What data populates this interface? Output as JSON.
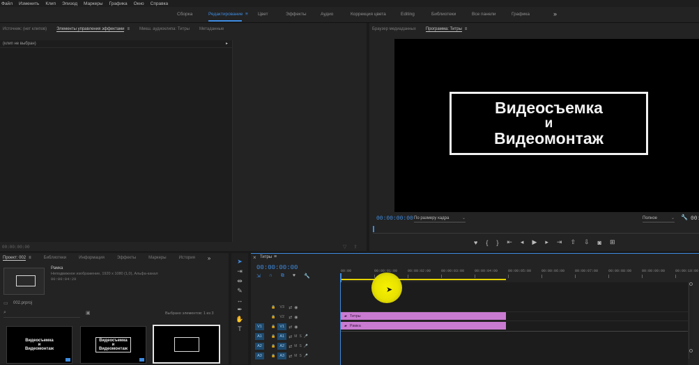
{
  "menu": [
    "Файл",
    "Изменить",
    "Клип",
    "Эпизод",
    "Маркеры",
    "Графика",
    "Окно",
    "Справка"
  ],
  "workspaces": {
    "items": [
      "Сборка",
      "Редактирование",
      "Цвет",
      "Эффекты",
      "Аудио",
      "Коррекция цвета",
      "Editing",
      "Библиотеки",
      "Все панели",
      "Графика"
    ],
    "more": "»",
    "menu_glyph": "≡"
  },
  "source_panel": {
    "tabs": [
      "Источник: (нет клипов)",
      "Элементы управления эффектами",
      "Микш. аудиоклипа: Титры",
      "Метаданные"
    ],
    "no_clip": "(клип не выбран)",
    "timecode": "00:00:00:00",
    "menu_glyph": "≡",
    "arrow": "▸"
  },
  "program_monitor": {
    "tabs": [
      "Браузер медиаданных",
      "Программа: Титры"
    ],
    "menu_glyph": "≡",
    "title_lines": [
      "Видеосъемка",
      "и",
      "Видеомонтаж"
    ],
    "timecode": "00:00:00:00",
    "fit": "По размеру кадра",
    "quality": "Полное",
    "end_tc": "00:",
    "wrench": "🔧"
  },
  "project_panel": {
    "tabs": [
      "Проект: 002",
      "Библиотеки",
      "Информация",
      "Эффекты",
      "Маркеры",
      "История"
    ],
    "more": "»",
    "menu_glyph": "≡",
    "item_name": "Рамка",
    "item_desc": "Неподвижное изображение, 1920 x 1080 (1,0), Альфа-канал",
    "item_duration": "00:00:04:29",
    "file": "002.prproj",
    "selected_count": "Выбрано элементов: 1 из 3",
    "thumb_title": [
      "Видеосъемка",
      "и",
      "Видеомонтаж"
    ]
  },
  "timeline": {
    "close": "×",
    "tab": "Титры",
    "menu_glyph": "≡",
    "timecode": "00:00:00:00",
    "ruler": [
      "00:00",
      "00:00:01:00",
      "00:00:02:00",
      "00:00:03:00",
      "00:00:04:00",
      "00:00:05:00",
      "00:00:06:00",
      "00:00:07:00",
      "00:00:08:00",
      "00:00:09:00",
      "00:00:10:00"
    ],
    "video_tracks": [
      {
        "target": "",
        "name": "V3"
      },
      {
        "target": "",
        "name": "V2"
      },
      {
        "target": "V1",
        "name": "V1"
      }
    ],
    "audio_tracks": [
      {
        "target": "A1",
        "name": "A1",
        "m": "M",
        "s": "S"
      },
      {
        "target": "A2",
        "name": "A2",
        "m": "M",
        "s": "S"
      },
      {
        "target": "A3",
        "name": "A3",
        "m": "M",
        "s": "S"
      }
    ],
    "clips": [
      {
        "label": "Титры",
        "track": "V2",
        "start": 0,
        "end": 5
      },
      {
        "label": "Рамка",
        "track": "V1",
        "start": 0,
        "end": 5
      }
    ]
  },
  "colors": {
    "accent": "#3d8be0",
    "clip": "#c97bd1",
    "cursor_highlight": "#f4f000"
  }
}
